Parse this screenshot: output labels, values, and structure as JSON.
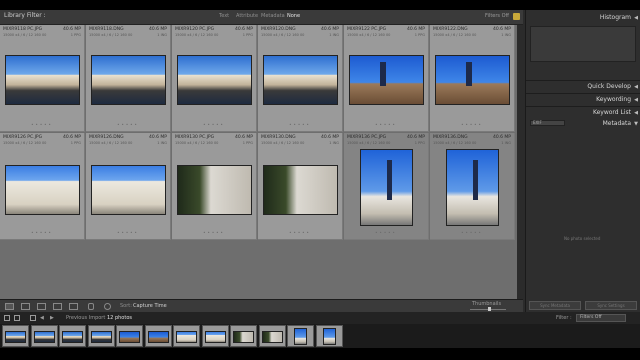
{
  "filter_bar": {
    "title": "Library Filter :",
    "options": [
      "Text",
      "Attribute",
      "Metadata",
      "None"
    ],
    "active": "None",
    "right_label": "Filters Off"
  },
  "grid": {
    "cells": [
      {
        "name": "MIXR9118 PC.JPG",
        "mp": "40.6 MP",
        "sub": "15000 x4 / 6 / 12 160 00",
        "sub2": "1 PPG",
        "kind": "river"
      },
      {
        "name": "MIXR9118.DNG",
        "mp": "40.6 MP",
        "sub": "15000 x4 / 6 / 12 160 00",
        "sub2": "1 ING",
        "kind": "river"
      },
      {
        "name": "MIXR9120 PC.JPG",
        "mp": "40.6 MP",
        "sub": "15000 x4 / 6 / 12 160 00",
        "sub2": "1 PPG",
        "kind": "river"
      },
      {
        "name": "MIXR9120.DNG",
        "mp": "40.6 MP",
        "sub": "15000 x4 / 6 / 12 160 00",
        "sub2": "1 ING",
        "kind": "river"
      },
      {
        "name": "MIXR9122 PC.JPG",
        "mp": "40.6 MP",
        "sub": "15000 x4 / 6 / 12 160 00",
        "sub2": "1 PPG",
        "kind": "church"
      },
      {
        "name": "MIXR9122.DNG",
        "mp": "40.6 MP",
        "sub": "15000 x4 / 6 / 12 160 00",
        "sub2": "1 ING",
        "kind": "church"
      },
      {
        "name": "MIXR9126 PC.JPG",
        "mp": "40.6 MP",
        "sub": "15000 x4 / 6 / 12 160 00",
        "sub2": "1 PPG",
        "kind": "build"
      },
      {
        "name": "MIXR9126.DNG",
        "mp": "40.6 MP",
        "sub": "15000 x4 / 6 / 12 160 00",
        "sub2": "1 ING",
        "kind": "build"
      },
      {
        "name": "MIXR9130 PC.JPG",
        "mp": "40.6 MP",
        "sub": "15000 x4 / 6 / 12 160 00",
        "sub2": "1 PPG",
        "kind": "tree"
      },
      {
        "name": "MIXR9130.DNG",
        "mp": "40.6 MP",
        "sub": "15000 x4 / 6 / 12 160 00",
        "sub2": "1 ING",
        "kind": "tree"
      },
      {
        "name": "MIXR9136 PC.JPG",
        "mp": "40.6 MP",
        "sub": "15000 x4 / 6 / 12 160 00",
        "sub2": "1 PPG",
        "kind": "tower"
      },
      {
        "name": "MIXR9136.DNG",
        "mp": "40.6 MP",
        "sub": "15000 x4 / 6 / 12 160 00",
        "sub2": "1 ING",
        "kind": "tower"
      }
    ]
  },
  "toolbar": {
    "sort_label": "Sort:",
    "sort_value": "Capture Time",
    "thumbnails_label": "Thumbnails"
  },
  "right_panel": {
    "histogram": "Histogram",
    "quick_develop": "Quick Develop",
    "keywording": "Keywording",
    "keyword_list": "Keyword List",
    "metadata": "Metadata",
    "metadata_preset": "EXIF",
    "no_photo": "No photo selected",
    "sync_metadata": "Sync Metadata",
    "sync_settings": "Sync Settings"
  },
  "filmstrip_bar": {
    "source": "Previous Import",
    "count": "12 photos",
    "filter_label": "Filter :",
    "filter_value": "Filters Off"
  }
}
